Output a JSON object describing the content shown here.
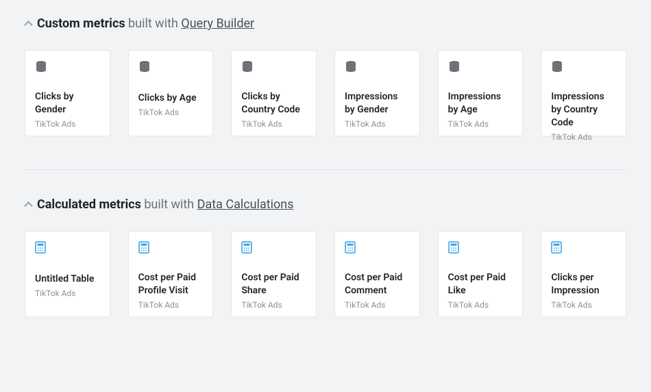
{
  "sections": {
    "custom": {
      "title_strong": "Custom metrics",
      "title_rest": "built with",
      "title_link": "Query Builder",
      "cards": [
        {
          "title": "Clicks by Gender",
          "source": "TikTok Ads"
        },
        {
          "title": "Clicks by Age",
          "source": "TikTok Ads"
        },
        {
          "title": "Clicks by Country Code",
          "source": "TikTok Ads"
        },
        {
          "title": "Impressions by Gender",
          "source": "TikTok Ads"
        },
        {
          "title": "Impressions by Age",
          "source": "TikTok Ads"
        },
        {
          "title": "Impressions by Country Code",
          "source": "TikTok Ads"
        }
      ]
    },
    "calculated": {
      "title_strong": "Calculated metrics",
      "title_rest": "built with",
      "title_link": "Data Calculations",
      "cards": [
        {
          "title": "Untitled Table",
          "source": "TikTok Ads"
        },
        {
          "title": "Cost per Paid Profile Visit",
          "source": "TikTok Ads"
        },
        {
          "title": "Cost per Paid Share",
          "source": "TikTok Ads"
        },
        {
          "title": "Cost per Paid Comment",
          "source": "TikTok Ads"
        },
        {
          "title": "Cost per Paid Like",
          "source": "TikTok Ads"
        },
        {
          "title": "Clicks per Impression",
          "source": "TikTok Ads"
        }
      ]
    }
  }
}
